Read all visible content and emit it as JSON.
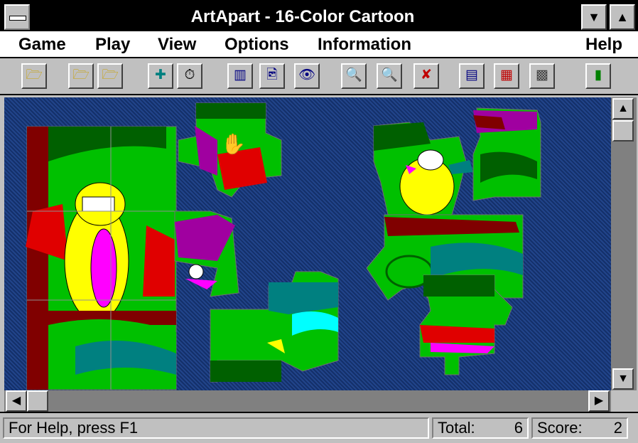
{
  "window": {
    "title": "ArtApart - 16-Color Cartoon"
  },
  "menu": {
    "game": "Game",
    "play": "Play",
    "view": "View",
    "options": "Options",
    "information": "Information",
    "help": "Help"
  },
  "toolbar": {
    "icons": [
      "open-folder-icon",
      "open-folder-2-icon",
      "open-folder-3-icon",
      "puzzle-piece-icon",
      "stopwatch-icon",
      "bar-chart-icon",
      "picture-info-icon",
      "eye-icon",
      "zoom-out-icon",
      "zoom-in-icon",
      "zoom-reset-icon",
      "window-layout-icon",
      "colors-icon",
      "grid-image-icon",
      "exit-door-icon"
    ]
  },
  "status": {
    "help_text": "For Help, press F1",
    "total_label": "Total:",
    "total_value": "6",
    "score_label": "Score:",
    "score_value": "2"
  },
  "colors": {
    "background_pattern": "#1a3a7a",
    "grass": "#00c000",
    "dark_green": "#006000",
    "teal": "#008080",
    "bird_yellow": "#ffff00",
    "magenta": "#ff00ff",
    "red": "#e00000",
    "trunk": "#800000"
  }
}
